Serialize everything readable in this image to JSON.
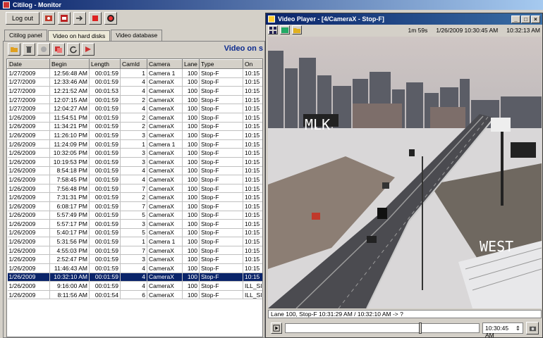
{
  "main_window": {
    "title": "Citilog - Monitor"
  },
  "toolbar": {
    "logout_label": "Log out"
  },
  "tabs": [
    {
      "label": "Citilog panel"
    },
    {
      "label": "Video on hard disks"
    },
    {
      "label": "Video database"
    }
  ],
  "panel": {
    "section_title": "Video on s"
  },
  "table": {
    "columns": [
      "Date",
      "Begin",
      "Length",
      "CamId",
      "Camera",
      "Lane",
      "Type",
      "On"
    ],
    "rows": [
      [
        "1/27/2009",
        "12:56:48 AM",
        "00:01:59",
        "1",
        "Camera 1",
        "100",
        "Stop-F",
        "10:15"
      ],
      [
        "1/27/2009",
        "12:33:46 AM",
        "00:01:59",
        "4",
        "CameraX",
        "100",
        "Stop-F",
        "10:15"
      ],
      [
        "1/27/2009",
        "12:21:52 AM",
        "00:01:53",
        "4",
        "CameraX",
        "100",
        "Stop-F",
        "10:15"
      ],
      [
        "1/27/2009",
        "12:07:15 AM",
        "00:01:59",
        "2",
        "CameraX",
        "100",
        "Stop-F",
        "10:15"
      ],
      [
        "1/27/2009",
        "12:04:27 AM",
        "00:01:59",
        "4",
        "CameraX",
        "100",
        "Stop-F",
        "10:15"
      ],
      [
        "1/26/2009",
        "11:54:51 PM",
        "00:01:59",
        "2",
        "CameraX",
        "100",
        "Stop-F",
        "10:15"
      ],
      [
        "1/26/2009",
        "11:34:21 PM",
        "00:01:59",
        "2",
        "CameraX",
        "100",
        "Stop-F",
        "10:15"
      ],
      [
        "1/26/2009",
        "11:26:10 PM",
        "00:01:59",
        "3",
        "CameraX",
        "100",
        "Stop-F",
        "10:15"
      ],
      [
        "1/26/2009",
        "11:24:09 PM",
        "00:01:59",
        "1",
        "Camera 1",
        "100",
        "Stop-F",
        "10:15"
      ],
      [
        "1/26/2009",
        "10:32:05 PM",
        "00:01:59",
        "3",
        "CameraX",
        "100",
        "Stop-F",
        "10:15"
      ],
      [
        "1/26/2009",
        "10:19:53 PM",
        "00:01:59",
        "3",
        "CameraX",
        "100",
        "Stop-F",
        "10:15"
      ],
      [
        "1/26/2009",
        "8:54:18 PM",
        "00:01:59",
        "4",
        "CameraX",
        "100",
        "Stop-F",
        "10:15"
      ],
      [
        "1/26/2009",
        "7:58:45 PM",
        "00:01:59",
        "4",
        "CameraX",
        "100",
        "Stop-F",
        "10:15"
      ],
      [
        "1/26/2009",
        "7:56:48 PM",
        "00:01:59",
        "7",
        "CameraX",
        "100",
        "Stop-F",
        "10:15"
      ],
      [
        "1/26/2009",
        "7:31:31 PM",
        "00:01:59",
        "2",
        "CameraX",
        "100",
        "Stop-F",
        "10:15"
      ],
      [
        "1/26/2009",
        "6:08:17 PM",
        "00:01:59",
        "7",
        "CameraX",
        "100",
        "Stop-F",
        "10:15"
      ],
      [
        "1/26/2009",
        "5:57:49 PM",
        "00:01:59",
        "5",
        "CameraX",
        "100",
        "Stop-F",
        "10:15"
      ],
      [
        "1/26/2009",
        "5:57:17 PM",
        "00:01:59",
        "3",
        "CameraX",
        "100",
        "Stop-F",
        "10:15"
      ],
      [
        "1/26/2009",
        "5:40:17 PM",
        "00:01:59",
        "5",
        "CameraX",
        "100",
        "Stop-F",
        "10:15"
      ],
      [
        "1/26/2009",
        "5:31:56 PM",
        "00:01:59",
        "1",
        "Camera 1",
        "100",
        "Stop-F",
        "10:15"
      ],
      [
        "1/26/2009",
        "4:55:03 PM",
        "00:01:59",
        "7",
        "CameraX",
        "100",
        "Stop-F",
        "10:15"
      ],
      [
        "1/26/2009",
        "2:52:47 PM",
        "00:01:59",
        "3",
        "CameraX",
        "100",
        "Stop-F",
        "10:15"
      ],
      [
        "1/26/2009",
        "11:46:43 AM",
        "00:01:59",
        "4",
        "CameraX",
        "100",
        "Stop-F",
        "10:15"
      ],
      [
        "1/26/2009",
        "10:32:10 AM",
        "00:01:59",
        "4",
        "CameraX",
        "100",
        "Stop-F",
        "10:15"
      ],
      [
        "1/26/2009",
        "9:16:00 AM",
        "00:01:59",
        "4",
        "CameraX",
        "100",
        "Stop-F",
        "ILL_SI"
      ],
      [
        "1/26/2009",
        "8:11:56 AM",
        "00:01:54",
        "6",
        "CameraX",
        "100",
        "Stop-F",
        "ILL_SI"
      ]
    ],
    "selected_row_index": 23
  },
  "video_player": {
    "title": "Video Player - [4/CameraX - Stop-F]",
    "duration": "1m 59s",
    "timestamp": "1/26/2009 10:30:45 AM",
    "clock": "10:32:13 AM",
    "overlay_left": "MLK",
    "overlay_right": "WEST",
    "status_text": "Lane 100, Stop-F 10:31:29 AM / 10:32:10 AM -> ?",
    "time_field": "10:30:45 AM",
    "slider_position_fraction": 0.69
  },
  "colors": {
    "title_blue": "#0a246a",
    "selection": "#0a246a",
    "section_title": "#0b2a8f"
  },
  "icons": [
    "app-icon",
    "camera-icon",
    "grid-layout-icon",
    "record-icon",
    "play-icon",
    "snapshot-icon",
    "minimize-icon",
    "maximize-icon",
    "close-icon"
  ]
}
